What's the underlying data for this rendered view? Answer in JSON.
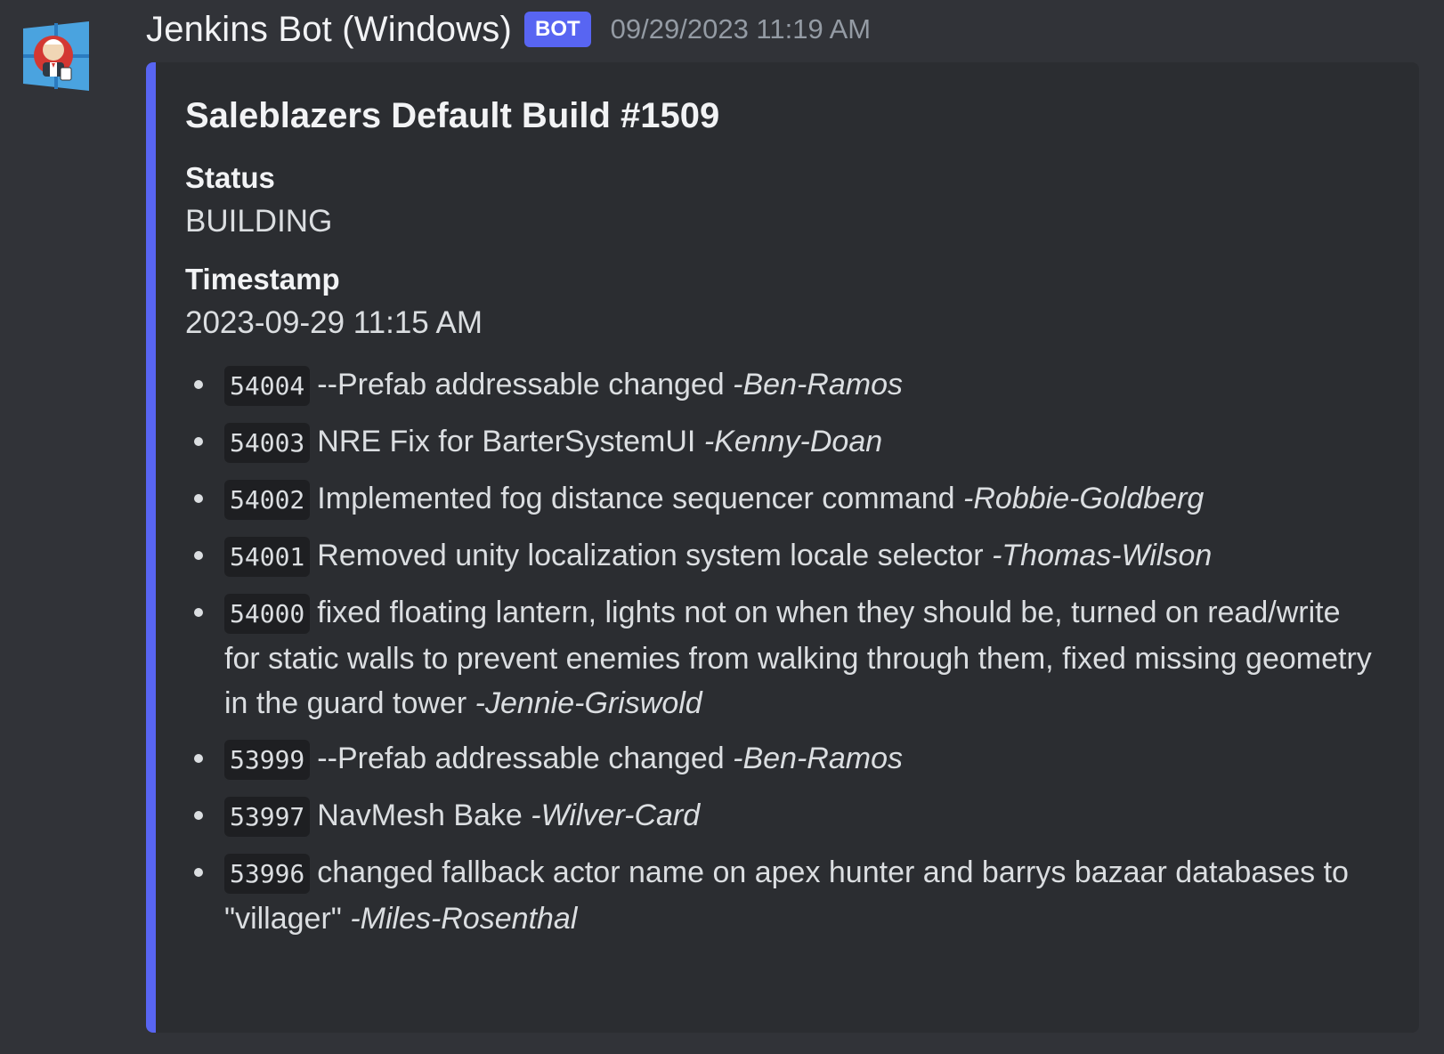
{
  "message": {
    "author": "Jenkins Bot (Windows)",
    "badge": "BOT",
    "timestamp": "09/29/2023 11:19 AM",
    "avatar_icon": "jenkins-butler-icon"
  },
  "embed": {
    "accent_color": "#5865f2",
    "title": "Saleblazers Default Build #1509",
    "fields": [
      {
        "name": "Status",
        "value": "BUILDING"
      },
      {
        "name": "Timestamp",
        "value": "2023-09-29 11:15 AM"
      }
    ],
    "commits": [
      {
        "id": "54004",
        "message": "--Prefab addressable changed",
        "author": "-Ben-Ramos"
      },
      {
        "id": "54003",
        "message": "NRE Fix for BarterSystemUI",
        "author": "-Kenny-Doan"
      },
      {
        "id": "54002",
        "message": "Implemented fog distance sequencer command",
        "author": "-Robbie-Goldberg"
      },
      {
        "id": "54001",
        "message": "Removed unity localization system locale selector",
        "author": "-Thomas-Wilson"
      },
      {
        "id": "54000",
        "message": "fixed floating lantern, lights not on when they should be, turned on read/write for static walls to prevent enemies from walking through them, fixed missing geometry in the guard tower",
        "author": "-Jennie-Griswold"
      },
      {
        "id": "53999",
        "message": "--Prefab addressable changed",
        "author": "-Ben-Ramos"
      },
      {
        "id": "53997",
        "message": "NavMesh Bake",
        "author": "-Wilver-Card"
      },
      {
        "id": "53996",
        "message": "changed fallback actor name on apex hunter and barrys bazaar databases to \"villager\"",
        "author": "-Miles-Rosenthal"
      }
    ]
  }
}
